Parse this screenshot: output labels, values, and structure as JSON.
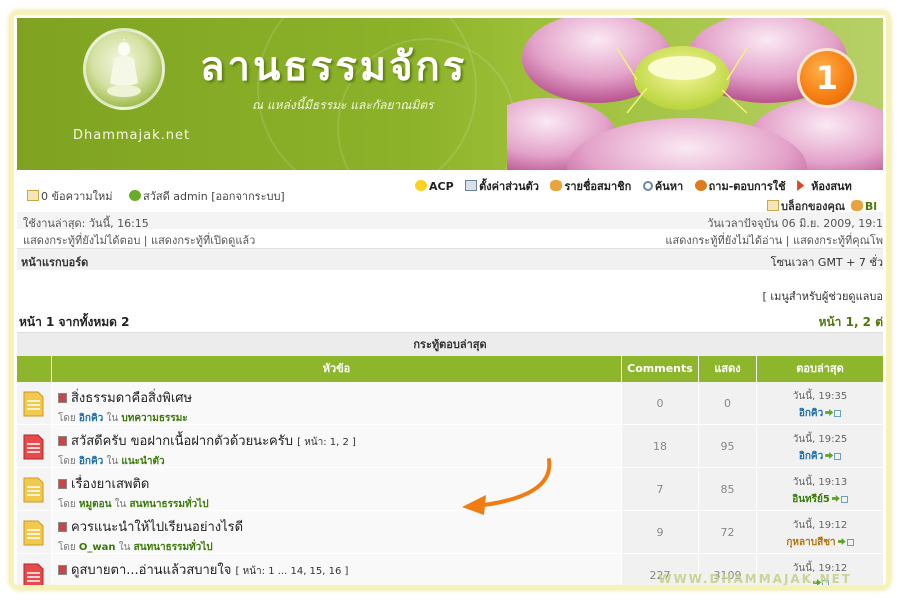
{
  "colors": {
    "brand_green": "#8db62c",
    "accent_orange": "#f57c10",
    "link_green": "#3b7a0a",
    "link_blue": "#1d6fa8"
  },
  "header": {
    "title": "ลานธรรมจักร",
    "tagline": "ณ แหล่งนี้มีธรรมะ และกัลยาณมิตร",
    "site_name": "Dhammajak.net",
    "badge": "1"
  },
  "nav": {
    "messages": "0 ข้อความใหม่",
    "hello": "สวัสดี admin [ออกจากระบบ]",
    "links": [
      {
        "label": "ACP",
        "icon": "lightbulb-icon"
      },
      {
        "label": "ตั้งค่าส่วนตัว",
        "icon": "profile-card-icon"
      },
      {
        "label": "รายชื่อสมาชิก",
        "icon": "members-icon"
      },
      {
        "label": "ค้นหา",
        "icon": "search-icon"
      },
      {
        "label": "ถาม-ตอบการใช้",
        "icon": "help-icon"
      },
      {
        "label": "ห้องสนท",
        "icon": "chat-icon"
      }
    ],
    "links2": [
      {
        "label": "บล็อกของคุณ",
        "icon": "mail-icon"
      },
      {
        "label": "Bl",
        "icon": "blog-icon"
      }
    ]
  },
  "info": {
    "last_visit": "ใช้งานล่าสุด: วันนี้, 16:15",
    "current_time": "วันเวลาปัจจุบัน 06 มิ.ย. 2009, 19:1",
    "left_links": "แสดงกระทู้ที่ยังไม่ได้ตอบ | แสดงกระทู้ที่เปิดดูแล้ว",
    "right_links": "แสดงกระทู้ที่ยังไม่ได้อ่าน | แสดงกระทู้ที่คุณโพ"
  },
  "crumb": {
    "home": "หน้าแรกบอร์ด",
    "timezone": "โซนเวลา GMT + 7 ชั่ว"
  },
  "helper_menu": "[ เมนูสำหรับผู้ช่วยดูแลบอ",
  "pagination": {
    "left": "หน้า 1 จากทั้งหมด 2",
    "right": "หน้า 1, 2  ต่"
  },
  "table": {
    "title": "กระทู้ตอบล่าสุด",
    "headers": {
      "topic": "หัวข้อ",
      "comments": "Comments",
      "views": "แสดง",
      "last": "ตอบล่าสุด"
    },
    "rows": [
      {
        "title": "สิ่งธรรมดาคือสิ่งพิเศษ",
        "pages": "",
        "by": "โดย",
        "author": "อิกคิว",
        "in": "ใน",
        "forum": "บทความธรรมะ",
        "author_color": "blue",
        "comments": "0",
        "views": "0",
        "last_time": "วันนี้, 19:35",
        "last_user": "อิกคิว",
        "last_color": "blue",
        "folder": "yellow"
      },
      {
        "title": "สวัสดีครับ ขอฝากเนื้อฝากตัวด้วยนะครับ",
        "pages": "[ หน้า: 1, 2 ]",
        "by": "โดย",
        "author": "อิกคิว",
        "in": "ใน",
        "forum": "แนะนำตัว",
        "author_color": "blue",
        "comments": "18",
        "views": "95",
        "last_time": "วันนี้, 19:25",
        "last_user": "อิกคิว",
        "last_color": "blue",
        "folder": "red"
      },
      {
        "title": "เรื่องยาเสพติด",
        "pages": "",
        "by": "โดย",
        "author": "หมูตอน",
        "in": "ใน",
        "forum": "สนทนาธรรมทั่วไป",
        "author_color": "green",
        "comments": "7",
        "views": "85",
        "last_time": "วันนี้, 19:13",
        "last_user": "อินทรีย์5",
        "last_color": "green",
        "folder": "yellow"
      },
      {
        "title": "ควรแนะนำให้ไปเรียนอย่างไรดี",
        "pages": "",
        "by": "โดย",
        "author": "O_wan",
        "in": "ใน",
        "forum": "สนทนาธรรมทั่วไป",
        "author_color": "green",
        "comments": "9",
        "views": "72",
        "last_time": "วันนี้, 19:12",
        "last_user": "กุหลาบสีชา",
        "last_color": "orange",
        "folder": "yellow"
      },
      {
        "title": "ดูสบายตา...อ่านแล้วสบายใจ",
        "pages": "[ หน้า: 1 ... 14, 15, 16 ]",
        "by": "",
        "author": "",
        "in": "",
        "forum": "",
        "author_color": "green",
        "comments": "227",
        "views": "3109",
        "last_time": "วันนี้, 19:12",
        "last_user": "",
        "last_color": "green",
        "folder": "red"
      }
    ]
  },
  "watermark": "WWW.DHAMMAJAK.NET"
}
